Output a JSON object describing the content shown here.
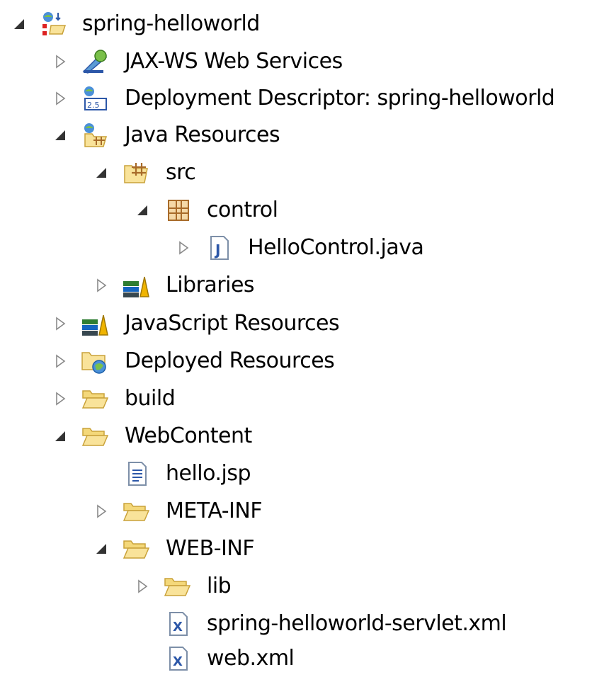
{
  "project_explorer": {
    "root": {
      "label": "spring-helloworld",
      "expanded": true,
      "icon": "web-project-icon"
    },
    "nodes": [
      {
        "label": "JAX-WS Web Services",
        "expanded": false,
        "icon": "jax-ws-services-icon"
      },
      {
        "label": "Deployment Descriptor: spring-helloworld",
        "expanded": false,
        "icon": "deployment-descriptor-icon"
      },
      {
        "label": "Java Resources",
        "expanded": true,
        "icon": "java-resources-icon"
      },
      {
        "label": "src",
        "expanded": true,
        "icon": "source-folder-icon"
      },
      {
        "label": "control",
        "expanded": true,
        "icon": "package-icon"
      },
      {
        "label": "HelloControl.java",
        "expanded": false,
        "icon": "java-file-icon"
      },
      {
        "label": "Libraries",
        "expanded": false,
        "icon": "libraries-icon"
      },
      {
        "label": "JavaScript Resources",
        "expanded": false,
        "icon": "libraries-icon"
      },
      {
        "label": "Deployed Resources",
        "expanded": false,
        "icon": "deployed-resources-icon"
      },
      {
        "label": "build",
        "expanded": false,
        "icon": "folder-icon"
      },
      {
        "label": "WebContent",
        "expanded": true,
        "icon": "folder-icon"
      },
      {
        "label": "hello.jsp",
        "expanded": null,
        "icon": "jsp-file-icon"
      },
      {
        "label": "META-INF",
        "expanded": false,
        "icon": "folder-icon"
      },
      {
        "label": "WEB-INF",
        "expanded": true,
        "icon": "folder-icon"
      },
      {
        "label": "lib",
        "expanded": false,
        "icon": "folder-icon"
      },
      {
        "label": "spring-helloworld-servlet.xml",
        "expanded": null,
        "icon": "xml-file-icon"
      },
      {
        "label": "web.xml",
        "expanded": null,
        "icon": "xml-file-icon"
      }
    ]
  },
  "colors": {
    "folder_fill": "#f9e39a",
    "folder_stroke": "#c9a23a",
    "toggle_expanded": "#333333",
    "toggle_collapsed": "#8a8a8a",
    "java_blue": "#2c57a8",
    "package_brown": "#a86b2a"
  }
}
